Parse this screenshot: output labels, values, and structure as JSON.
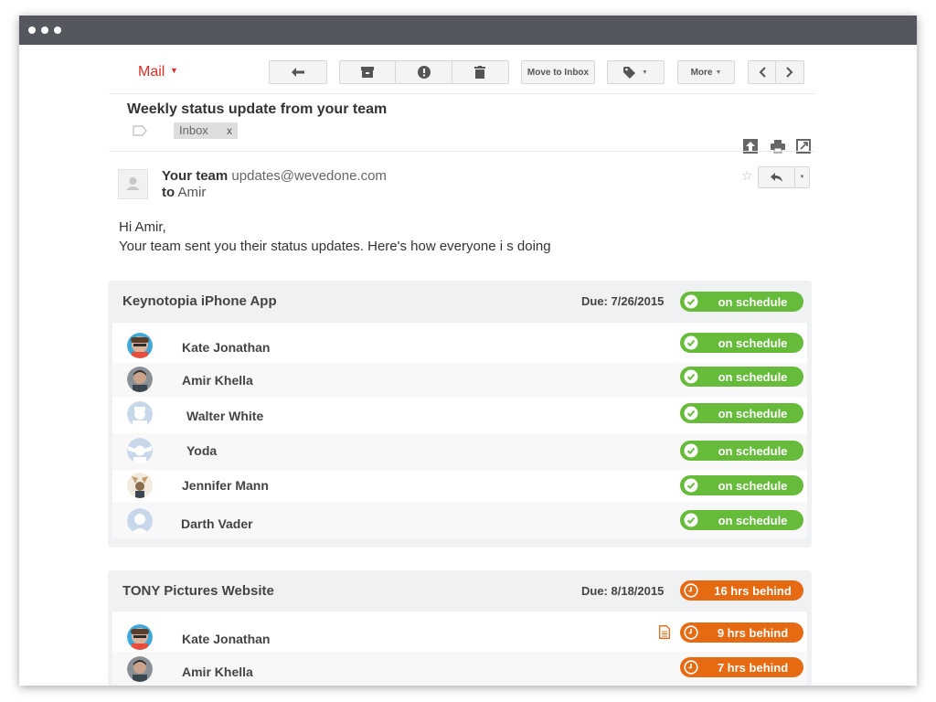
{
  "toolbar": {
    "mail_label": "Mail",
    "move_to_inbox_label": "Move to Inbox",
    "more_label": "More"
  },
  "email": {
    "subject": "Weekly status update from your team",
    "label_chip": "Inbox",
    "label_chip_close": "x",
    "sender_name": "Your team",
    "sender_email": "updates@wevedone.com",
    "to_prefix": "to",
    "to_name": "Amir",
    "greeting": "Hi Amir,",
    "intro": "Your team sent you their status updates. Here's how everyone i s doing"
  },
  "colors": {
    "on_schedule": "#66bb3a",
    "behind": "#e66a12",
    "mail_red": "#d93025"
  },
  "projects": [
    {
      "title": "Keynotopia iPhone App",
      "due": "Due: 7/26/2015",
      "status": "on schedule",
      "members": [
        {
          "name": "Kate Jonathan",
          "status": "on schedule"
        },
        {
          "name": "Amir Khella",
          "status": "on schedule"
        },
        {
          "name": "Walter White",
          "status": "on schedule"
        },
        {
          "name": "Yoda",
          "status": "on schedule"
        },
        {
          "name": "Jennifer Mann",
          "status": "on schedule"
        },
        {
          "name": "Darth Vader",
          "status": "on schedule"
        }
      ]
    },
    {
      "title": "TONY Pictures Website",
      "due": "Due: 8/18/2015",
      "status": "16 hrs behind",
      "members": [
        {
          "name": "Kate Jonathan",
          "status": "9 hrs behind"
        },
        {
          "name": "Amir Khella",
          "status": "7 hrs behind"
        }
      ]
    }
  ]
}
